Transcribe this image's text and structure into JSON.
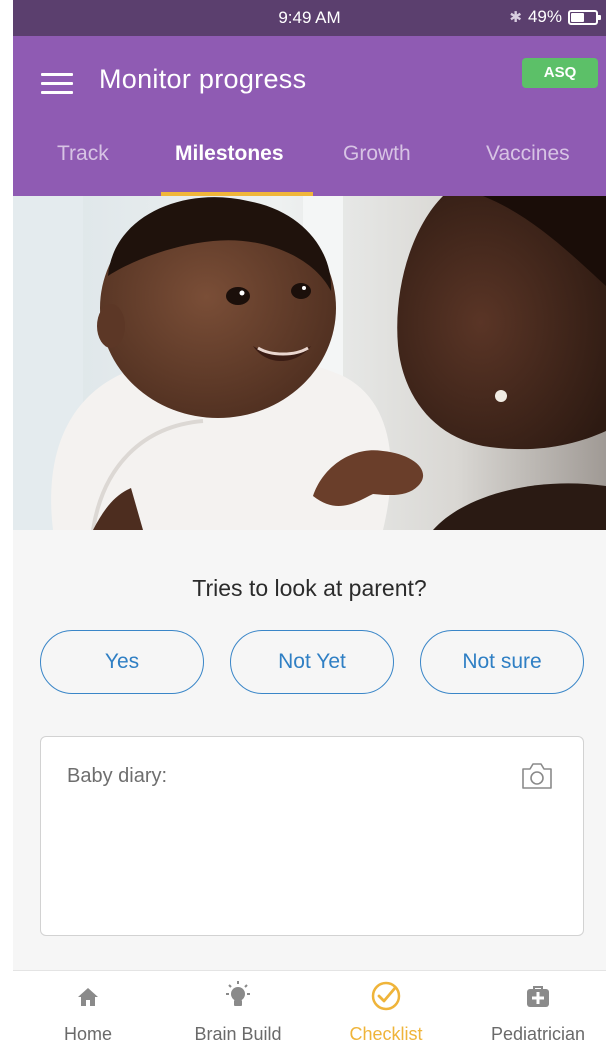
{
  "status_bar": {
    "time": "9:49 AM",
    "bluetooth_icon": "bluetooth-icon",
    "battery": "49%",
    "battery_level": 0.49
  },
  "header": {
    "title": "Monitor progress",
    "badge": "ASQ",
    "menu_icon": "hamburger-menu-icon",
    "colors": {
      "bar": "#8f5bb3",
      "badge": "#5cc068",
      "underline": "#f0b63a"
    }
  },
  "tabs": [
    {
      "label": "Track",
      "active": false
    },
    {
      "label": "Milestones",
      "active": true
    },
    {
      "label": "Growth",
      "active": false
    },
    {
      "label": "Vaccines",
      "active": false
    }
  ],
  "hero": {
    "image": "Photo of smiling baby held by parent"
  },
  "milestone": {
    "question": "Tries to look at parent?",
    "answers": [
      "Yes",
      "Not Yet",
      "Not sure"
    ]
  },
  "diary": {
    "placeholder": "Baby diary:",
    "camera_icon": "camera-icon"
  },
  "bottom_nav": [
    {
      "label": "Home",
      "icon": "home-icon",
      "active": false
    },
    {
      "label": "Brain Build",
      "icon": "lightbulb-icon",
      "active": false
    },
    {
      "label": "Checklist",
      "icon": "checklist-icon",
      "active": true
    },
    {
      "label": "Pediatrician",
      "icon": "medical-bag-icon",
      "active": false
    }
  ]
}
